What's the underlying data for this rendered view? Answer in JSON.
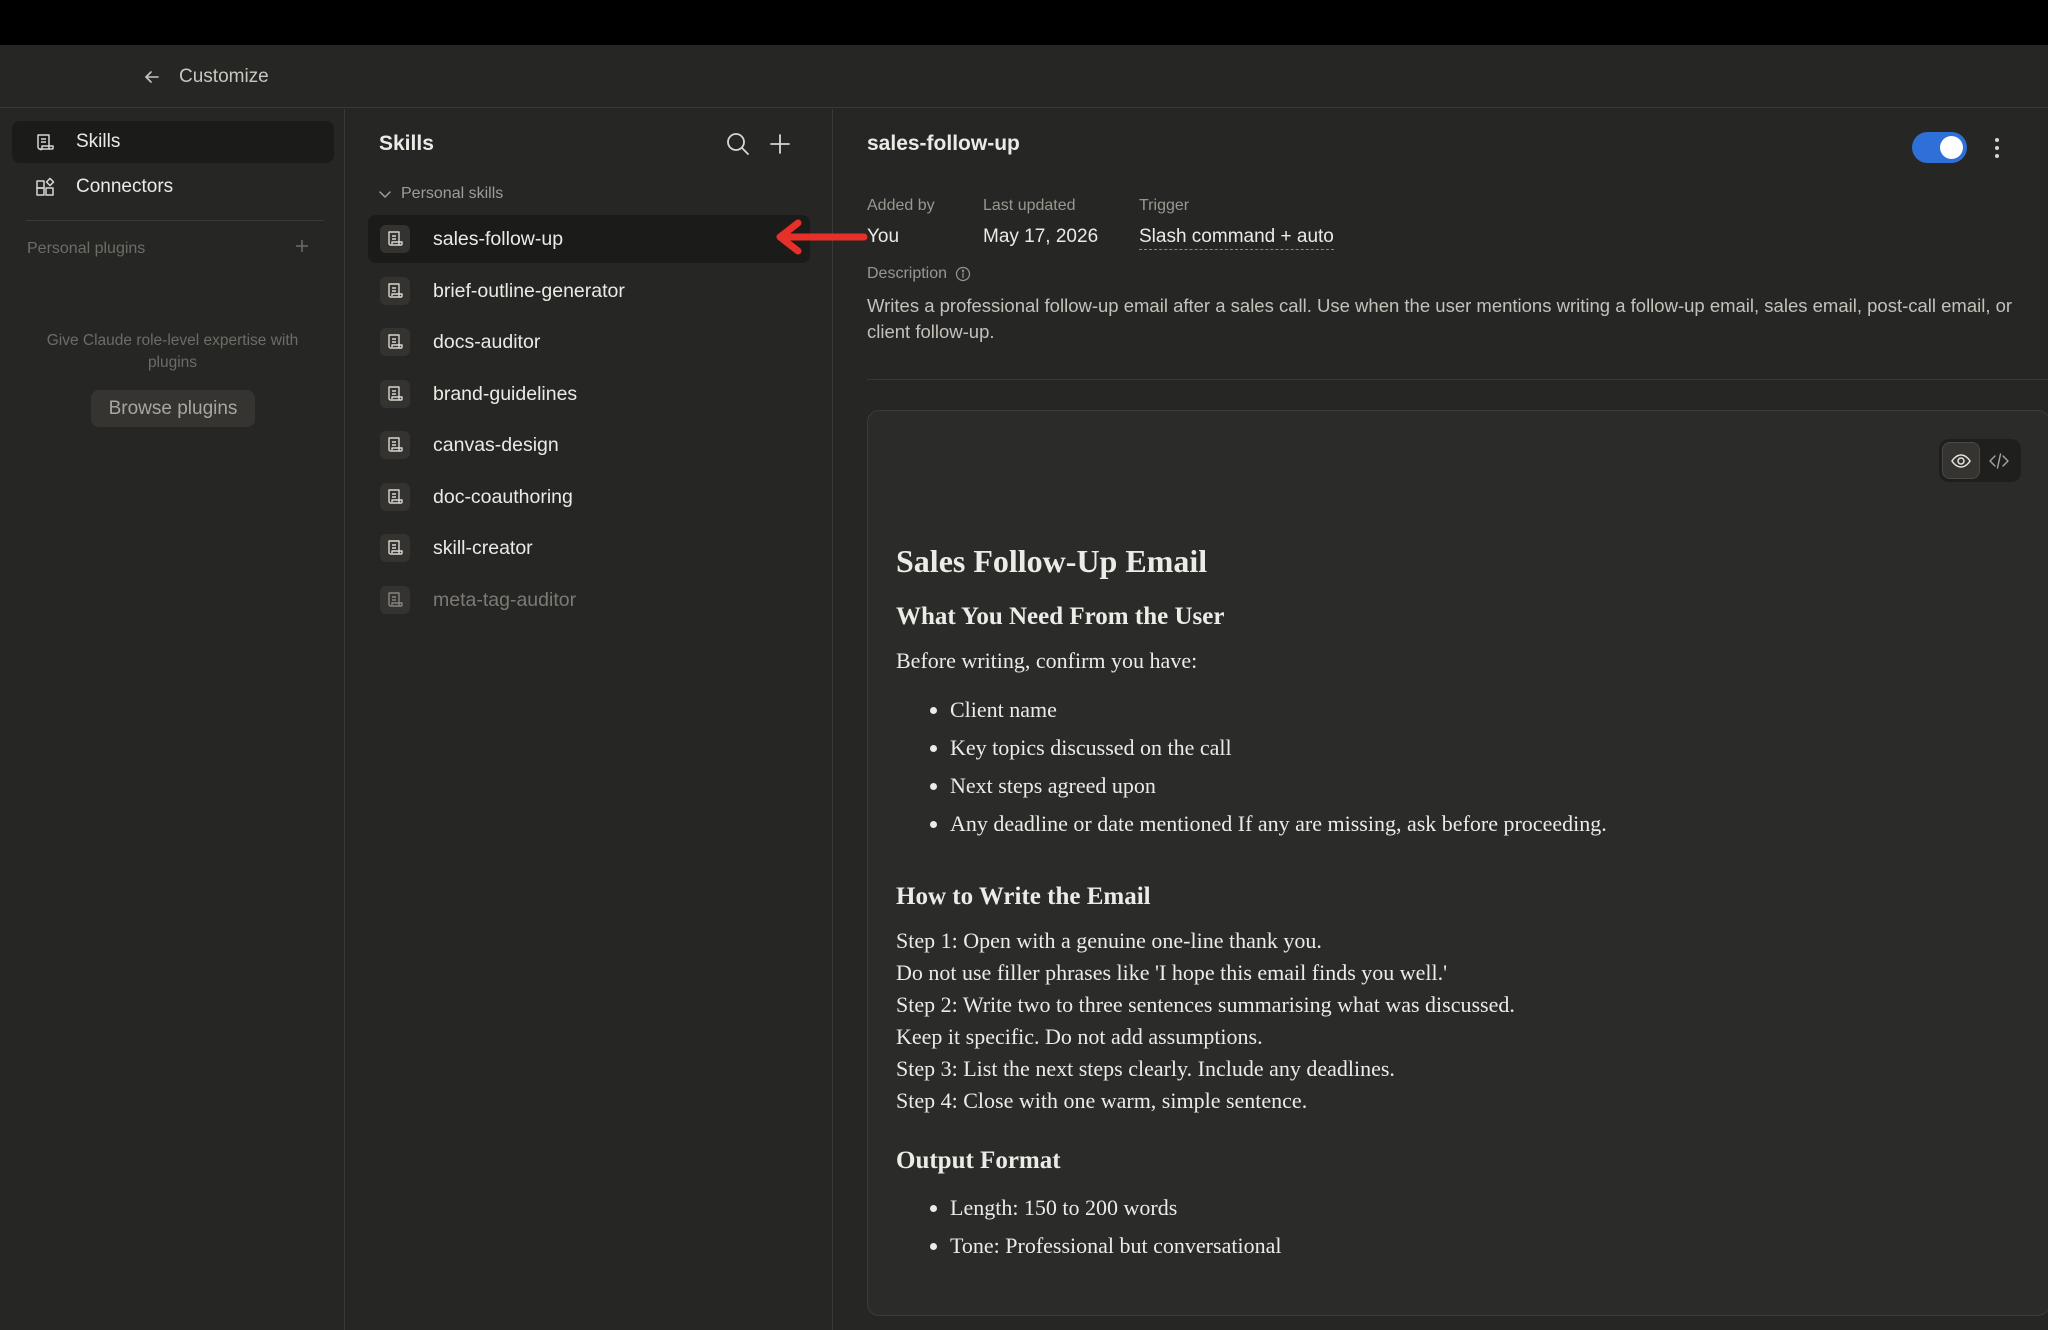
{
  "header": {
    "back_icon": "arrow-left-icon",
    "title": "Customize"
  },
  "sidebar": {
    "nav": [
      {
        "label": "Skills",
        "icon": "skills-icon",
        "active": true
      },
      {
        "label": "Connectors",
        "icon": "connectors-icon",
        "active": false
      }
    ],
    "plugins_section_label": "Personal plugins",
    "plugins_empty_text": "Give Claude role-level expertise with plugins",
    "browse_button": "Browse plugins"
  },
  "skills": {
    "title": "Skills",
    "group_label": "Personal skills",
    "items": [
      {
        "label": "sales-follow-up",
        "active": true,
        "enabled": true
      },
      {
        "label": "brief-outline-generator",
        "active": false,
        "enabled": true
      },
      {
        "label": "docs-auditor",
        "active": false,
        "enabled": true
      },
      {
        "label": "brand-guidelines",
        "active": false,
        "enabled": true
      },
      {
        "label": "canvas-design",
        "active": false,
        "enabled": true
      },
      {
        "label": "doc-coauthoring",
        "active": false,
        "enabled": true
      },
      {
        "label": "skill-creator",
        "active": false,
        "enabled": true
      },
      {
        "label": "meta-tag-auditor",
        "active": false,
        "enabled": false
      }
    ]
  },
  "detail": {
    "title": "sales-follow-up",
    "toggle_on": true,
    "added_by_label": "Added by",
    "added_by_value": "You",
    "last_updated_label": "Last updated",
    "last_updated_value": "May 17, 2026",
    "trigger_label": "Trigger",
    "trigger_value": "Slash command + auto",
    "description_label": "Description",
    "description_text": "Writes a professional follow-up email after a sales call. Use when the user mentions writing a follow-up email, sales email, post-call email, or client follow-up.",
    "content": {
      "h1": "Sales Follow-Up Email",
      "h2_need": "What You Need From the User",
      "need_intro": "Before writing, confirm you have:",
      "need_items": [
        "Client name",
        "Key topics discussed on the call",
        "Next steps agreed upon",
        "Any deadline or date mentioned If any are missing, ask before proceeding."
      ],
      "h2_how": "How to Write the Email",
      "how_lines": [
        "Step 1: Open with a genuine one-line thank you.",
        "Do not use filler phrases like 'I hope this email finds you well.'",
        "Step 2: Write two to three sentences summarising what was discussed.",
        "Keep it specific. Do not add assumptions.",
        "Step 3: List the next steps clearly. Include any deadlines.",
        "Step 4: Close with one warm, simple sentence."
      ],
      "h2_output": "Output Format",
      "output_items": [
        "Length: 150 to 200 words",
        "Tone: Professional but conversational"
      ]
    }
  },
  "colors": {
    "background": "#262624",
    "toggle_on": "#2e6fd8",
    "arrow_annotation": "#e8302a"
  }
}
